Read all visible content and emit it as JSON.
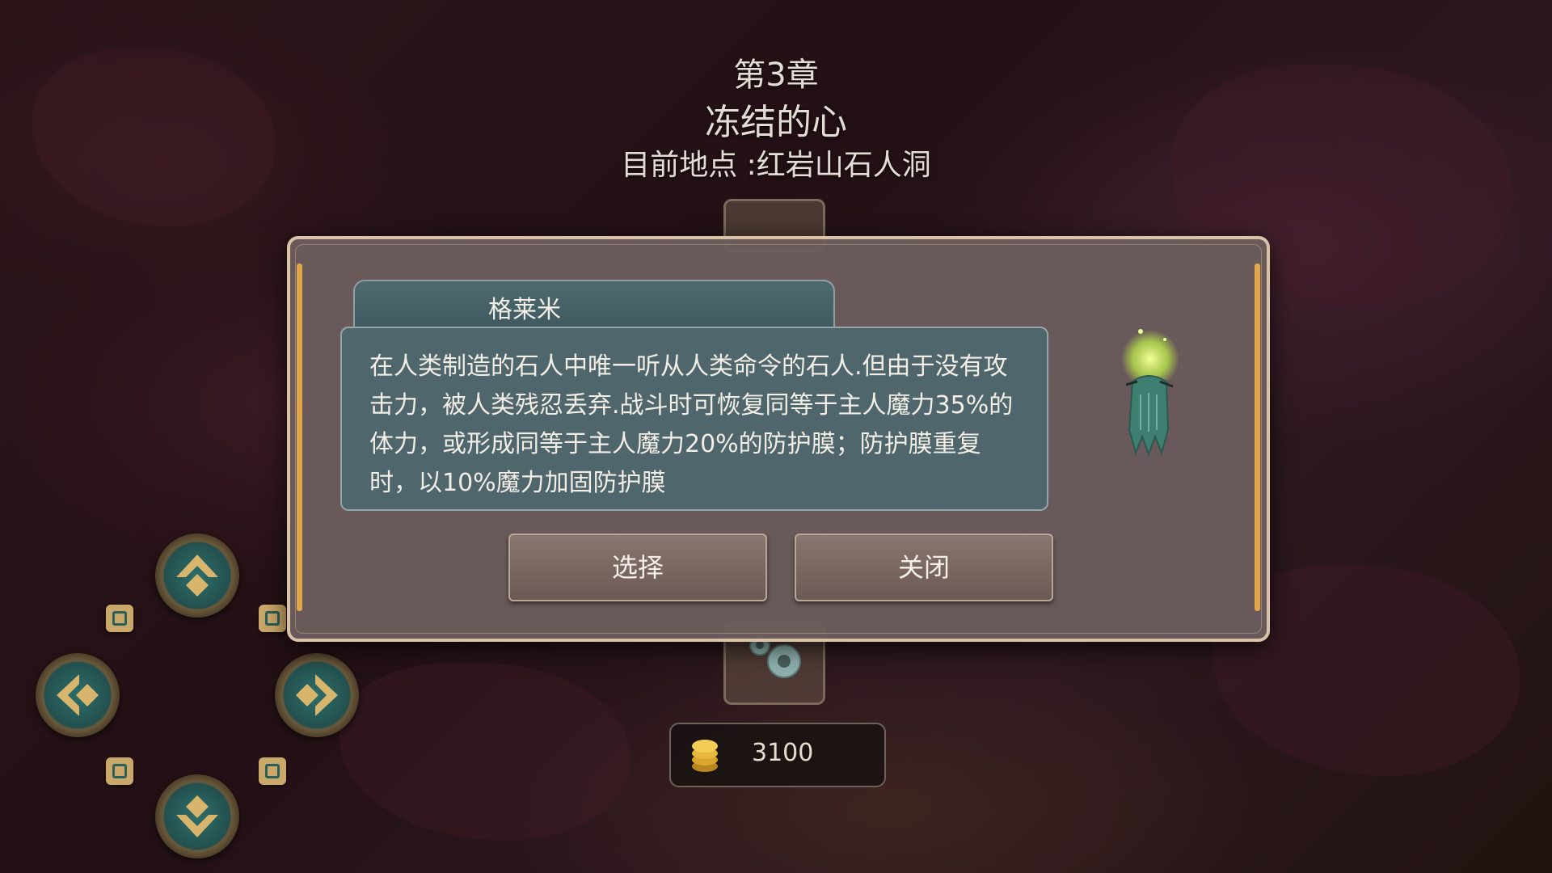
{
  "header": {
    "chapter": "第3章",
    "chapter_name": "冻结的心",
    "location": "目前地点 :红岩山石人洞"
  },
  "dialog": {
    "character_name": "格莱米",
    "description": "在人类制造的石人中唯一听从人类命令的石人.但由于没有攻击力，被人类残忍丢弃.战斗时可恢复同等于主人魔力35%的体力，或形成同等于主人魔力20%的防护膜；防护膜重复时，以10%魔力加固防护膜",
    "select_label": "选择",
    "close_label": "关闭"
  },
  "currency": {
    "coins": "3100"
  },
  "colors": {
    "dialog_bg": "#6c5c5c",
    "panel_teal": "#4f666c",
    "gold_accent": "#e2a64a",
    "dpad_teal": "#2d6e6a"
  },
  "icons": {
    "dpad": [
      "arrow-up-icon",
      "arrow-left-icon",
      "arrow-right-icon",
      "arrow-down-icon"
    ],
    "coin": "gold-coin-icon",
    "character": "golem-figure-icon"
  }
}
